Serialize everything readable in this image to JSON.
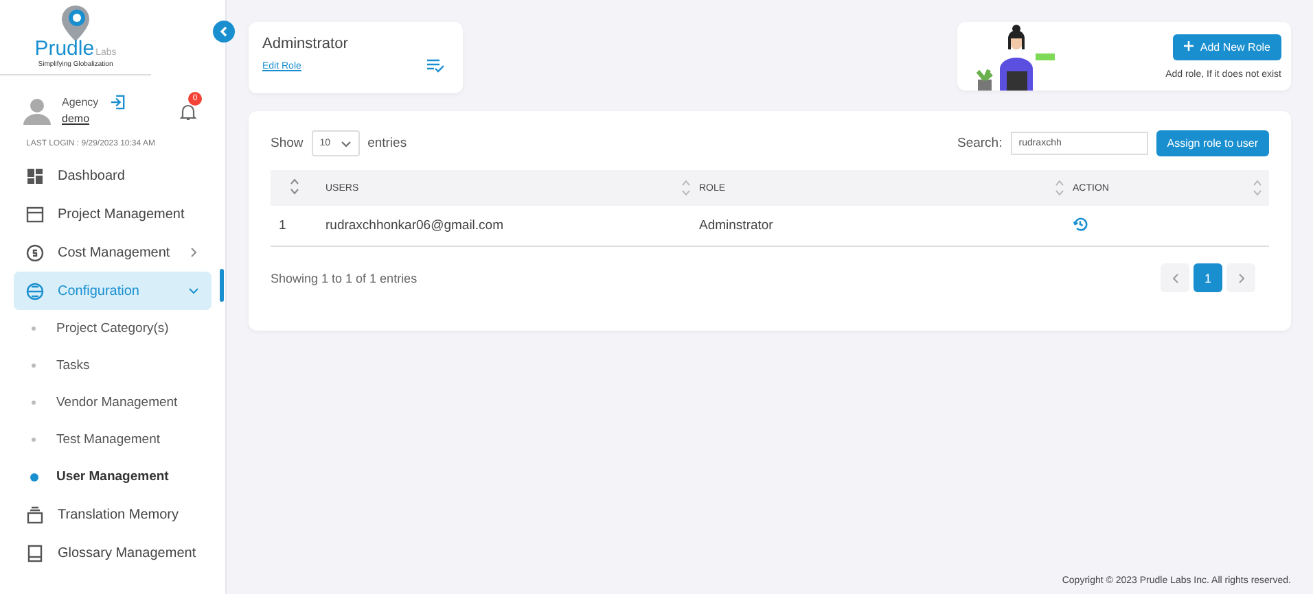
{
  "logo": {
    "name": "Prudle",
    "suffix": "Labs",
    "tagline": "Simplifying Globalization"
  },
  "user": {
    "role": "Agency",
    "name": "demo",
    "notifications": "0",
    "last_login": "LAST LOGIN : 9/29/2023 10:34 AM"
  },
  "sidebar": {
    "items": [
      {
        "kind": "item",
        "label": "Dashboard",
        "selected": false
      },
      {
        "kind": "item",
        "label": "Project Management",
        "selected": false
      },
      {
        "kind": "item",
        "label": "Cost Management",
        "selected": false,
        "expanded": false
      },
      {
        "kind": "item",
        "label": "Configuration",
        "selected": true,
        "expanded": true
      },
      {
        "kind": "sub",
        "label": "Project Category(s)",
        "selected": false
      },
      {
        "kind": "sub",
        "label": "Tasks",
        "selected": false
      },
      {
        "kind": "sub",
        "label": "Vendor Management",
        "selected": false
      },
      {
        "kind": "sub",
        "label": "Test Management",
        "selected": false
      },
      {
        "kind": "sub",
        "label": "User Management",
        "selected": true
      },
      {
        "kind": "item",
        "label": "Translation Memory",
        "selected": false
      },
      {
        "kind": "item",
        "label": "Glossary Management",
        "selected": false
      }
    ]
  },
  "role_card": {
    "title": "Adminstrator",
    "link": "Edit Role"
  },
  "add_card": {
    "button": "Add New Role",
    "hint": "Add role, If it does not exist"
  },
  "table": {
    "show_label": "Show",
    "page_size": "10",
    "entries_label": "entries",
    "search_label": "Search:",
    "search_value": "rudraxchh",
    "assign_button": "Assign role to user",
    "columns": [
      "USERS",
      "ROLE",
      "ACTION"
    ],
    "rows": [
      {
        "index": "1",
        "user": "rudraxchhonkar06@gmail.com",
        "role": "Adminstrator"
      }
    ],
    "info": "Showing 1 to 1 of 1 entries",
    "pages": [
      {
        "label": "1",
        "selected": true
      }
    ]
  },
  "footer": "Copyright © 2023 Prudle Labs Inc. All rights reserved."
}
